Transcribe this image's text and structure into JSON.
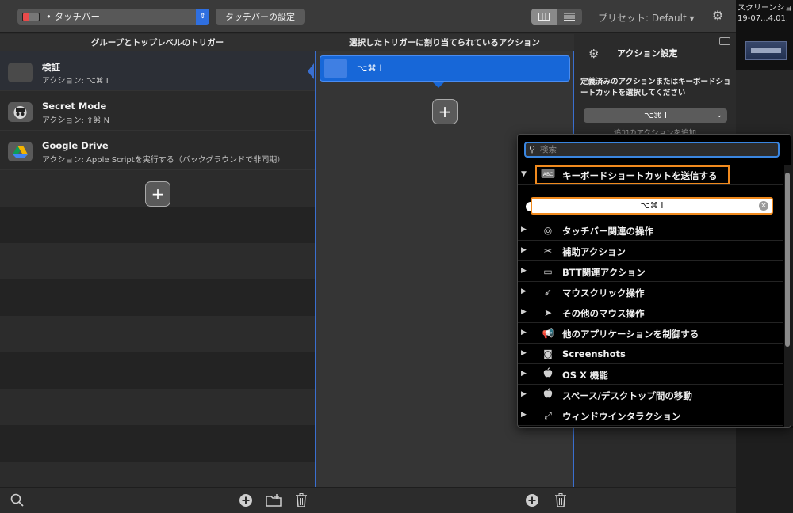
{
  "toolbar": {
    "touchbar_select": "• タッチバー",
    "touchbar_settings_button": "タッチバーの設定",
    "preset_label": "プリセット: Default ▾"
  },
  "desktop": {
    "caption_line1": "スクリーンショッ",
    "caption_line2": "19-07...4.01."
  },
  "columns": {
    "left_header": "グループとトップレベルのトリガー",
    "middle_header": "選択したトリガーに割り当てられているアクション"
  },
  "triggers": [
    {
      "title": "検証",
      "subtitle": "アクション: ⌥⌘ I"
    },
    {
      "title": "Secret Mode",
      "subtitle": "アクション: ⇧⌘ N"
    },
    {
      "title": "Google Drive",
      "subtitle": "アクション: Apple Scriptを実行する（バックグラウンドで非同期）"
    }
  ],
  "actions": [
    {
      "label": "⌥⌘ I"
    }
  ],
  "add_glyph": "+",
  "settings": {
    "title": "アクション設定",
    "description": "定義済みのアクションまたはキーボードショートカットを選択してください",
    "shortcut_value": "⌥⌘ I",
    "add_hint": "追加のアクションを追加"
  },
  "dropdown": {
    "search_placeholder": "検索",
    "expanded_category": "キーボードショートカットを送信する",
    "shortcut_field": "⌥⌘ I",
    "categories": [
      {
        "label": "タッチバー関連の操作",
        "icon": "◎"
      },
      {
        "label": "補助アクション",
        "icon": "✂"
      },
      {
        "label": "BTT関連アクション",
        "icon": "▭"
      },
      {
        "label": "マウスクリック操作",
        "icon": "➶"
      },
      {
        "label": "その他のマウス操作",
        "icon": "➤"
      },
      {
        "label": "他のアプリケーションを制御する",
        "icon": "📢"
      },
      {
        "label": "Screenshots",
        "icon": "◙"
      },
      {
        "label": "OS X 機能",
        "icon": ""
      },
      {
        "label": "スペース/デスクトップ間の移動",
        "icon": ""
      },
      {
        "label": "ウィンドウインタラクション",
        "icon": "⤢"
      }
    ]
  },
  "colors": {
    "accent": "#1767d8",
    "highlight_box": "#f08a1e"
  }
}
